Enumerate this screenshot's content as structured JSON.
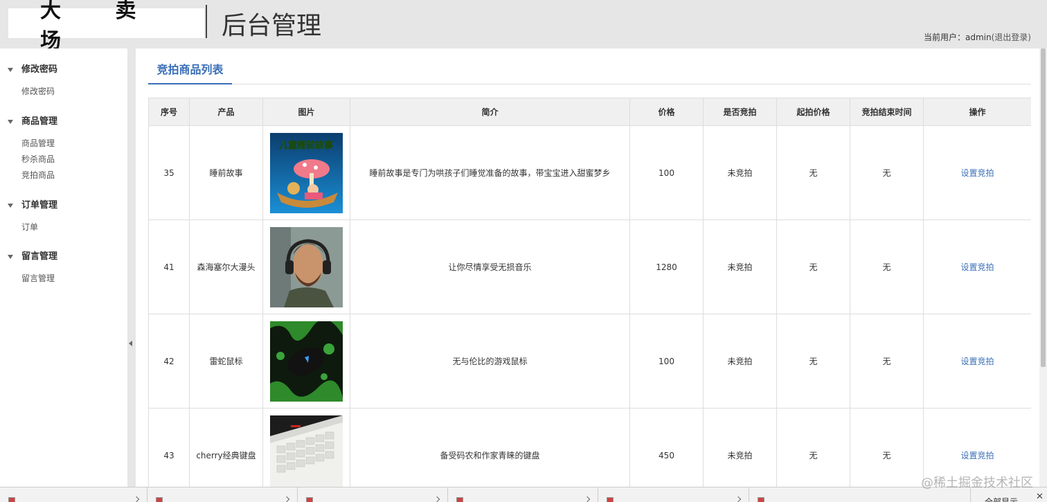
{
  "header": {
    "logo": "大 卖 场",
    "title": "后台管理",
    "current_user_label": "当前用户：admin",
    "logout_label": "(退出登录)"
  },
  "sidebar": {
    "groups": [
      {
        "title": "修改密码",
        "items": [
          "修改密码"
        ]
      },
      {
        "title": "商品管理",
        "items": [
          "商品管理",
          "秒杀商品",
          "竞拍商品"
        ]
      },
      {
        "title": "订单管理",
        "items": [
          "订单"
        ]
      },
      {
        "title": "留言管理",
        "items": [
          "留言管理"
        ]
      }
    ]
  },
  "main": {
    "tab_label": "竞拍商品列表",
    "columns": [
      "序号",
      "产品",
      "图片",
      "简介",
      "价格",
      "是否竞拍",
      "起拍价格",
      "竞拍结束时间",
      "操作"
    ],
    "rows": [
      {
        "id": "35",
        "product": "睡前故事",
        "image": "bedtime-story-cover",
        "intro": "睡前故事是专门为哄孩子们睡觉准备的故事，带宝宝进入甜蜜梦乡",
        "price": "100",
        "auction": "未竞拍",
        "start_price": "无",
        "end_time": "无",
        "action": "设置竞拍"
      },
      {
        "id": "41",
        "product": "森海塞尔大漫头",
        "image": "headphones-man-photo",
        "intro": "让你尽情享受无损音乐",
        "price": "1280",
        "auction": "未竞拍",
        "start_price": "无",
        "end_time": "无",
        "action": "设置竞拍"
      },
      {
        "id": "42",
        "product": "雷蛇鼠标",
        "image": "razer-mouse-photo",
        "intro": "无与伦比的游戏鼠标",
        "price": "100",
        "auction": "未竞拍",
        "start_price": "无",
        "end_time": "无",
        "action": "设置竞拍"
      },
      {
        "id": "43",
        "product": "cherry经典键盘",
        "image": "cherry-keyboard-photo",
        "intro": "备受码农和作家青睐的键盘",
        "price": "450",
        "auction": "未竞拍",
        "start_price": "无",
        "end_time": "无",
        "action": "设置竞拍"
      }
    ]
  },
  "thumbnails": {
    "bedtime_story_text": "儿童睡前故事"
  },
  "bottom_bar": {
    "show_all": "全部显示",
    "close": "✕"
  },
  "watermark": "@稀土掘金技术社区",
  "colors": {
    "accent": "#3a6fb7",
    "header_bg": "#e6e6e6",
    "table_header_bg": "#f0f0f0",
    "border": "#dddddd"
  }
}
